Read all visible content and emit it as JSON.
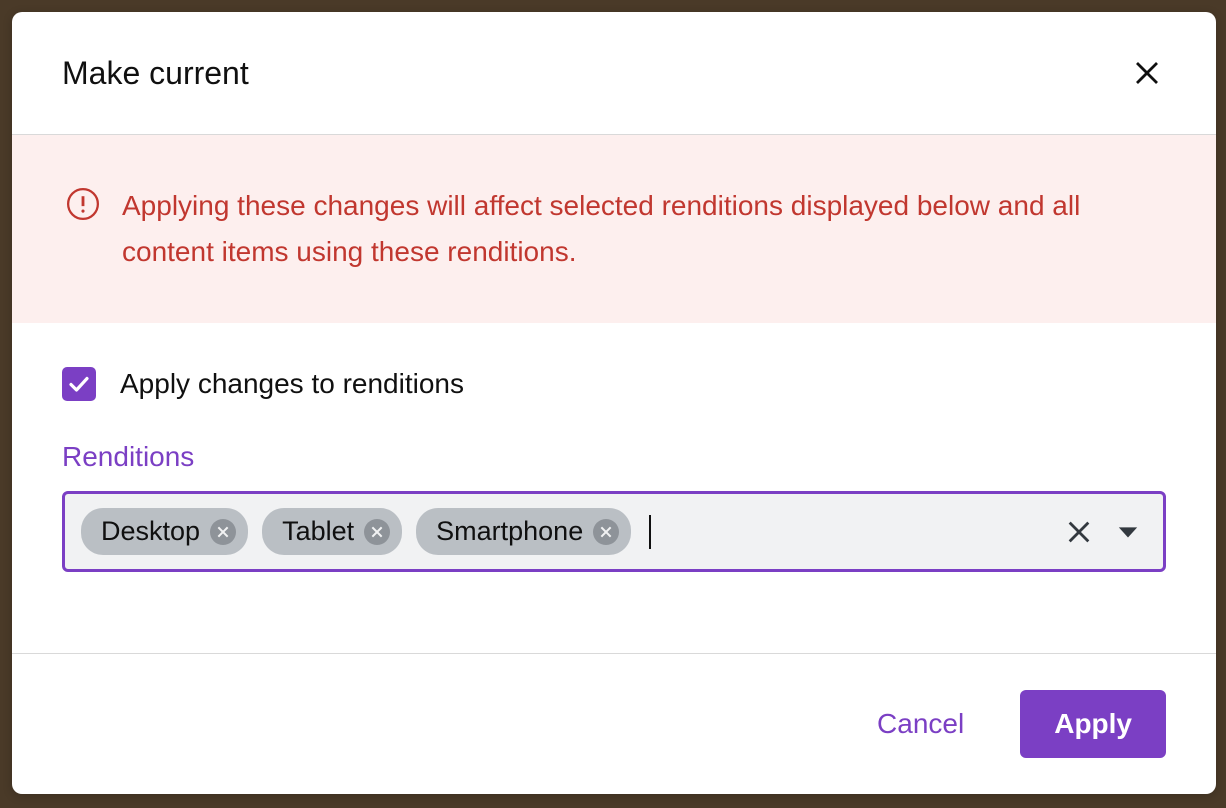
{
  "modal": {
    "title": "Make current",
    "alert": "Applying these changes will affect selected renditions displayed below and all content items using these renditions.",
    "checkbox_label": "Apply changes to renditions",
    "checkbox_checked": true,
    "field_label": "Renditions",
    "chips": [
      {
        "label": "Desktop"
      },
      {
        "label": "Tablet"
      },
      {
        "label": "Smartphone"
      }
    ],
    "footer": {
      "cancel": "Cancel",
      "apply": "Apply"
    }
  },
  "colors": {
    "accent": "#7b3fc4",
    "alert_bg": "#fdefee",
    "alert_fg": "#c1372f",
    "chip_bg": "#babfc4"
  }
}
